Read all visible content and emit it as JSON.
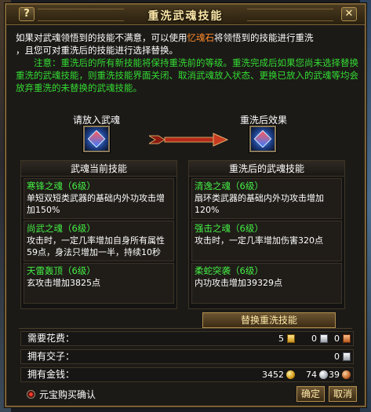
{
  "window": {
    "title": "重洗武魂技能",
    "help_label": "?",
    "close_label": "✕"
  },
  "description": {
    "line1_pre": "如果对武魂领悟到的技能不满意，可以使用",
    "line1_item": "忆魂石",
    "line1_post": "将领悟到的技能进行重洗",
    "line2": "，且您可对重洗后的技能进行选择替换。",
    "note": "注意：重洗后的所有新技能将保持重洗前的等级。重洗完成后如果您尚未选择替换重洗的武魂技能，则重洗技能界面关闭、取消武魂放入状态、更换已放入的武魂等均会放弃重洗的未替换的武魂技能。"
  },
  "slots": {
    "left_label": "请放入武魂",
    "right_label": "重洗后效果"
  },
  "current_skills": {
    "header": "武魂当前技能",
    "items": [
      {
        "name": "寒锋之魂（6级）",
        "desc": "单短双短类武器的基础内外功攻击增加150%"
      },
      {
        "name": "尚武之魂（6级）",
        "desc": "攻击时，一定几率增加自身所有属性59点，身法只增加一半，持续10秒"
      },
      {
        "name": "天雷轰顶（6级）",
        "desc": "玄攻击增加3825点"
      }
    ]
  },
  "washed_skills": {
    "header": "重洗后的武魂技能",
    "items": [
      {
        "name": "清逸之魂（6级）",
        "desc": "扇环类武器的基础内外功攻击增加120%"
      },
      {
        "name": "强击之魂（6级）",
        "desc": "攻击时，一定几率增加伤害320点"
      },
      {
        "name": "柔蛇突袭（6级）",
        "desc": "内功攻击增加39329点"
      }
    ]
  },
  "replace_button": "替换重洗技能",
  "cost": {
    "label": "需要花费：",
    "gold": "5",
    "silver": "0",
    "copper": "0"
  },
  "jiaozi": {
    "label": "拥有交子：",
    "value": "0"
  },
  "money": {
    "label": "拥有金钱：",
    "gold": "3452",
    "silver": "74",
    "copper": "39"
  },
  "footer": {
    "yuanbao_confirm": "元宝购买确认",
    "ok": "确定",
    "cancel": "取消"
  },
  "colors": {
    "skill_name": "#44ee44",
    "note": "#33dd33",
    "highlight": "#ff8a2a",
    "title": "#ffe9a8"
  }
}
